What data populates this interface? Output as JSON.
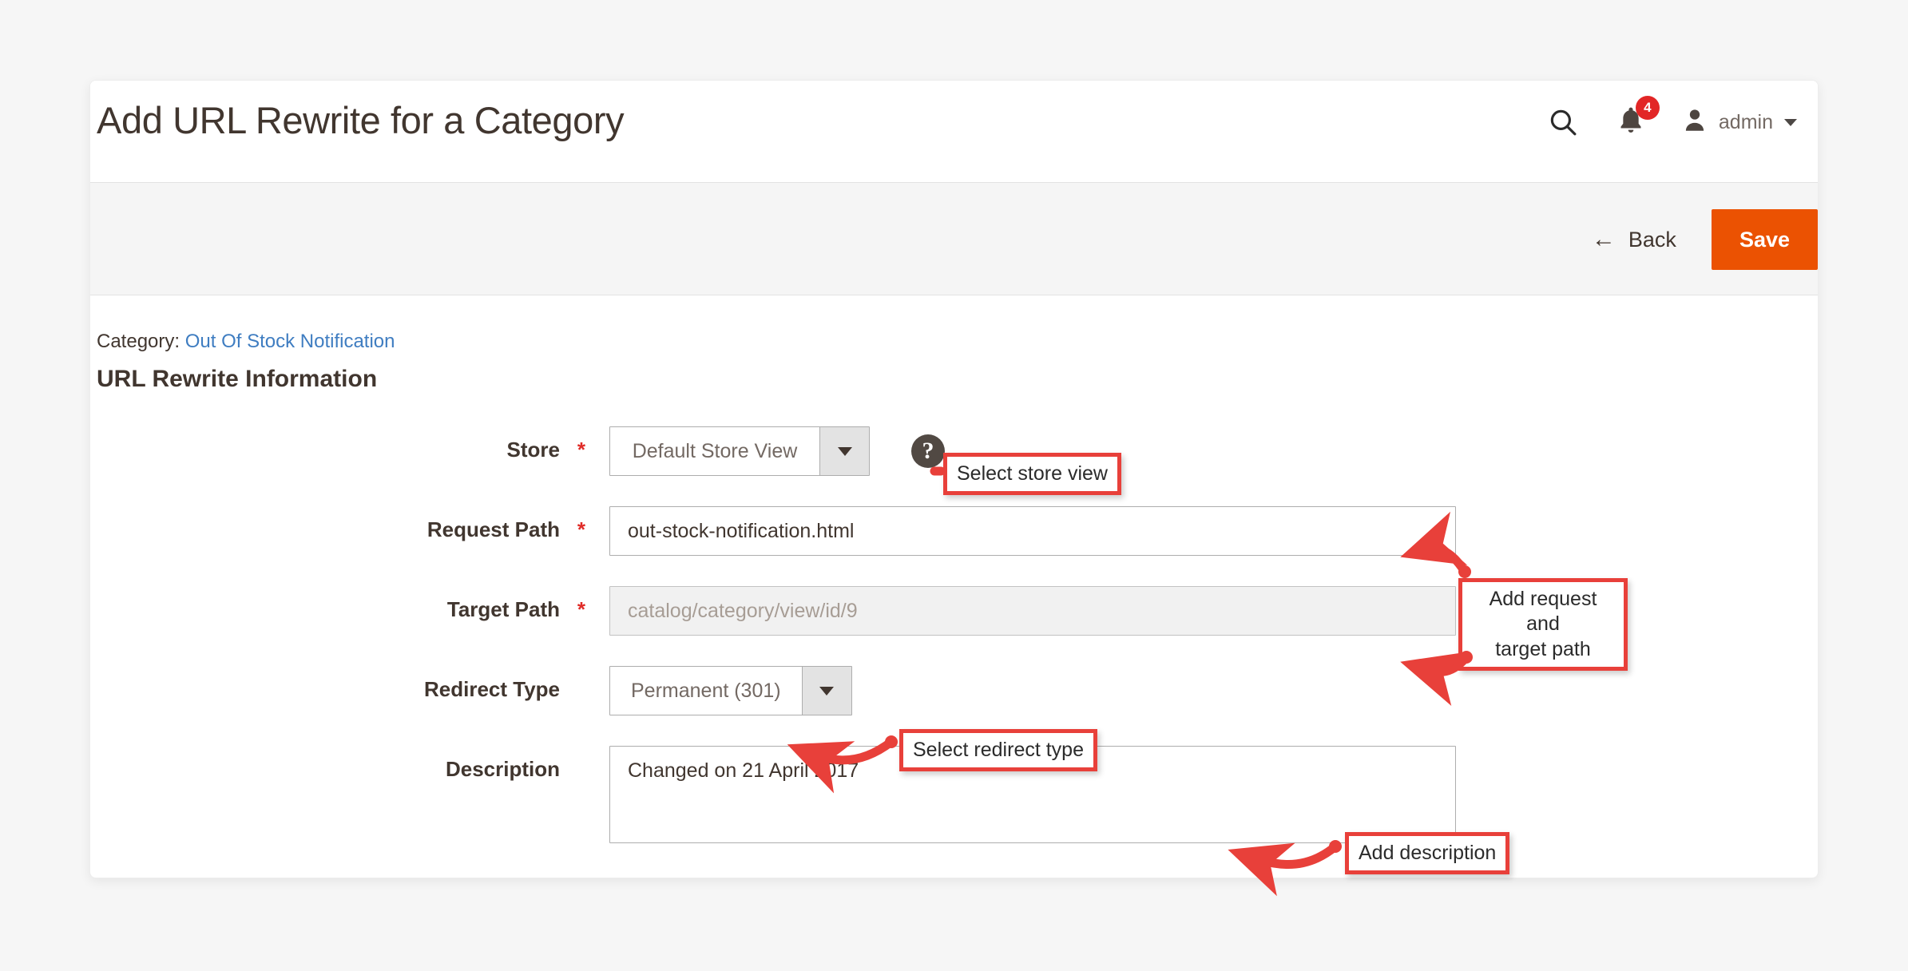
{
  "page": {
    "title": "Add URL Rewrite for a Category"
  },
  "header": {
    "search_icon": "search-icon",
    "notifications": {
      "icon": "bell-icon",
      "count": "4"
    },
    "user": {
      "icon": "user-icon",
      "name": "admin",
      "caret": "chevron-down-icon"
    }
  },
  "toolbar": {
    "back_label": "Back",
    "back_arrow": "←",
    "save_label": "Save",
    "save_color": "#eb5202"
  },
  "entity": {
    "prefix": "Category:",
    "link": "Out Of Stock Notification"
  },
  "section": {
    "title": "URL Rewrite Information"
  },
  "form": {
    "store": {
      "label": "Store",
      "required": "*",
      "value": "Default Store View",
      "help": "?"
    },
    "request_path": {
      "label": "Request Path",
      "required": "*",
      "value": "out-stock-notification.html",
      "placeholder": ""
    },
    "target_path": {
      "label": "Target Path",
      "required": "*",
      "value": "",
      "placeholder": "catalog/category/view/id/9"
    },
    "redirect_type": {
      "label": "Redirect Type",
      "required": "",
      "value": "Permanent (301)"
    },
    "description": {
      "label": "Description",
      "required": "",
      "value": "Changed on 21 April 2017"
    }
  },
  "annotations": {
    "store": "Select store view",
    "paths_line1": "Add request and",
    "paths_line2": "target path",
    "redirect": "Select redirect type",
    "description": "Add description",
    "color": "#e8403a"
  }
}
